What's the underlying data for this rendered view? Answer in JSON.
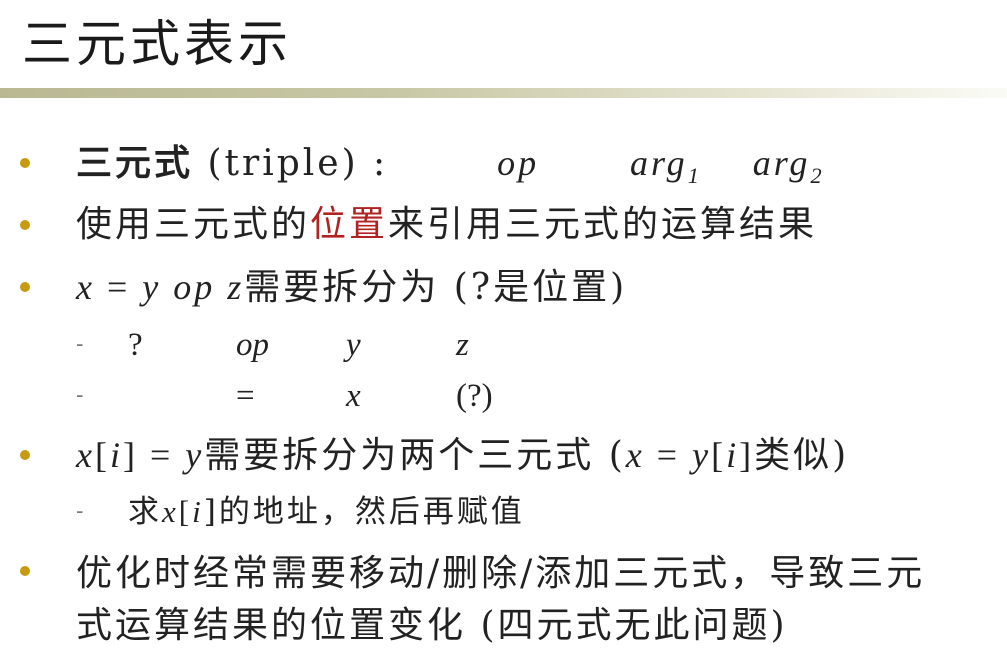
{
  "title": "三元式表示",
  "b1": {
    "term": "三元式",
    "paren": "(triple) :",
    "op": "op",
    "arg": "arg",
    "s1": "1",
    "s2": "2"
  },
  "b2": {
    "a": "使用三元式的",
    "red": "位置",
    "b": "来引用三元式的运算结果"
  },
  "b3": {
    "x": "x",
    "eq": " = ",
    "y": "y",
    "op": " op ",
    "z": "z",
    "rest": "需要拆分为 (?是位置)"
  },
  "s1": {
    "c1": "?",
    "c2": "op",
    "c3": "y",
    "c4": "z"
  },
  "s2": {
    "c1": "",
    "c2": "=",
    "c3": "x",
    "c4": "(?)"
  },
  "b4": {
    "x": "x",
    "lb": "[",
    "i": "i",
    "rb": "] = ",
    "y": "y",
    "rest": "需要拆分为两个三元式 (",
    "x2": "x",
    "eq": " = ",
    "y2": "y",
    "lb2": "[",
    "i2": "i",
    "rb2": "]",
    "tail": "类似)"
  },
  "s3": {
    "a": "求",
    "x": "x",
    "lb": "[",
    "i": "i",
    "b": "]的地址，然后再赋值"
  },
  "b5": {
    "line1": "优化时经常需要移动/删除/添加三元式，导致三元",
    "line2": "式运算结果的位置变化 (四元式无此问题)"
  },
  "dash": "-",
  "colors": {
    "bullet": "#c89a12",
    "highlight": "#b22222",
    "bar_start": "#b9b893"
  }
}
